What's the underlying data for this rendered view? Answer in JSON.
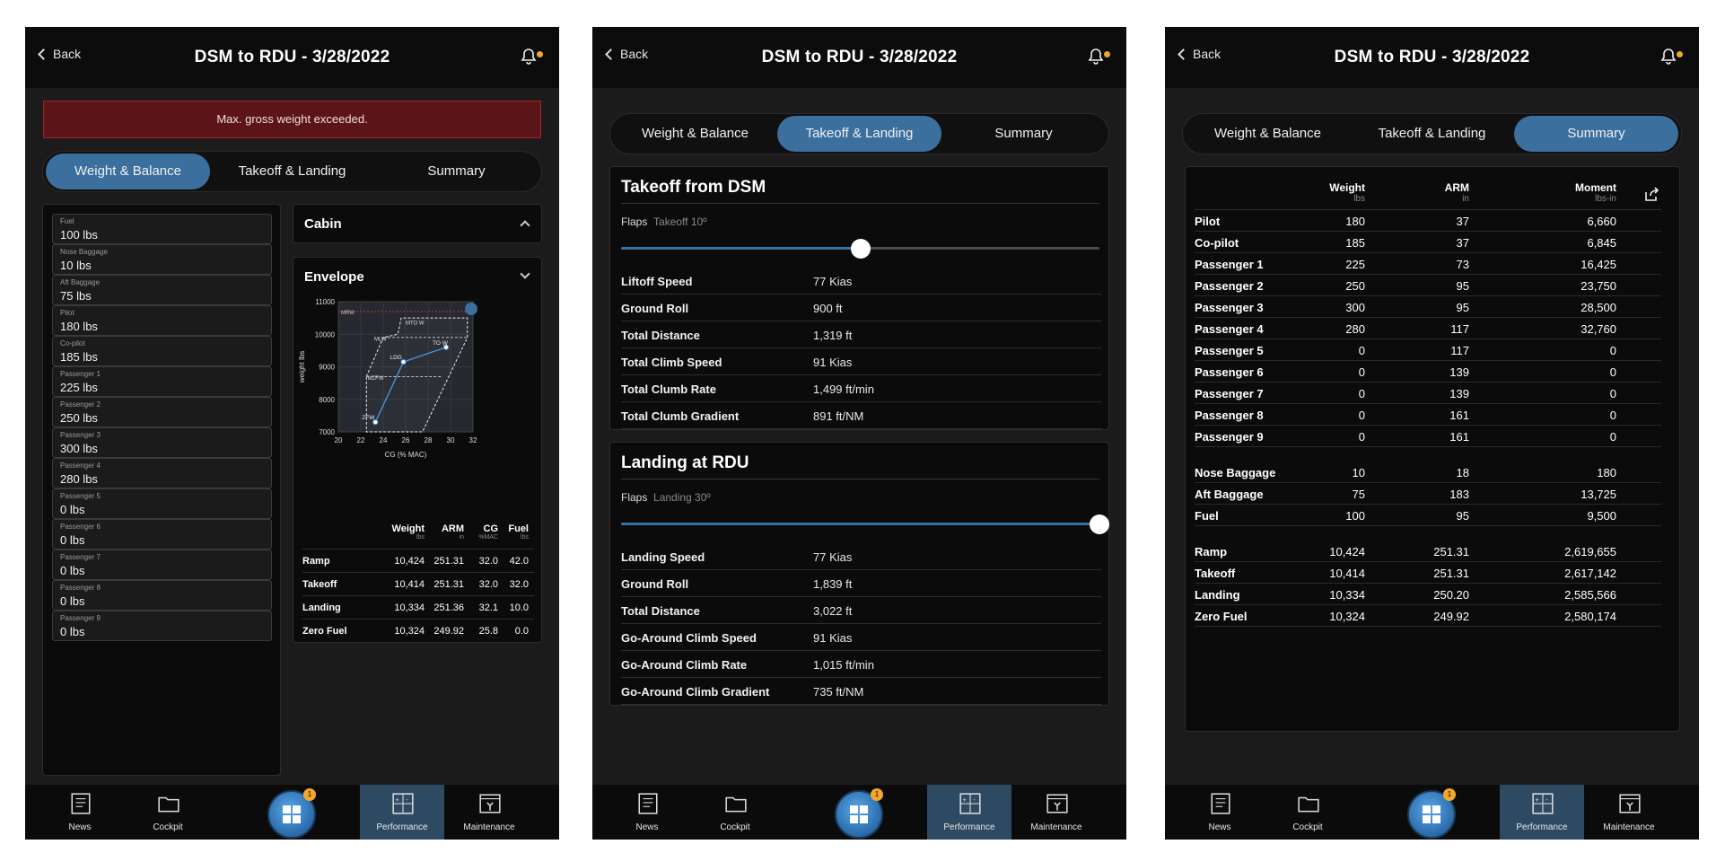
{
  "app": {
    "back_label": "Back",
    "title": "DSM to RDU - 3/28/2022",
    "tabs": [
      "Weight & Balance",
      "Takeoff & Landing",
      "Summary"
    ],
    "accent_color": "#3b6f9d",
    "notification_dot_color": "#f4a62a",
    "nav": [
      {
        "label": "News",
        "icon": "news-icon"
      },
      {
        "label": "Cockpit",
        "icon": "folder-icon"
      },
      {
        "label": "",
        "icon": "home-grid-icon",
        "badge": "1"
      },
      {
        "label": "Performance",
        "icon": "calculator-icon"
      },
      {
        "label": "Maintenance",
        "icon": "wrench-icon"
      }
    ]
  },
  "wb": {
    "alert": "Max. gross weight exceeded.",
    "fields": [
      {
        "label": "Fuel",
        "value": "100 lbs"
      },
      {
        "label": "Nose Baggage",
        "value": "10 lbs"
      },
      {
        "label": "Aft Baggage",
        "value": "75 lbs"
      },
      {
        "label": "Pilot",
        "value": "180 lbs"
      },
      {
        "label": "Co-pilot",
        "value": "185 lbs"
      },
      {
        "label": "Passenger 1",
        "value": "225 lbs"
      },
      {
        "label": "Passenger 2",
        "value": "250 lbs"
      },
      {
        "label": "Passenger 3",
        "value": "300 lbs"
      },
      {
        "label": "Passenger 4",
        "value": "280 lbs"
      },
      {
        "label": "Passenger 5",
        "value": "0 lbs"
      },
      {
        "label": "Passenger 6",
        "value": "0 lbs"
      },
      {
        "label": "Passenger 7",
        "value": "0 lbs"
      },
      {
        "label": "Passenger 8",
        "value": "0 lbs"
      },
      {
        "label": "Passenger 9",
        "value": "0 lbs"
      }
    ],
    "cabin_title": "Cabin",
    "envelope_title": "Envelope",
    "table_headers": [
      {
        "label": "Weight",
        "unit": "lbs"
      },
      {
        "label": "ARM",
        "unit": "in"
      },
      {
        "label": "CG",
        "unit": "%MAC"
      },
      {
        "label": "Fuel",
        "unit": "lbs"
      }
    ],
    "table_rows": [
      {
        "name": "Ramp",
        "weight": "10,424",
        "arm": "251.31",
        "cg": "32.0",
        "fuel": "42.0"
      },
      {
        "name": "Takeoff",
        "weight": "10,414",
        "arm": "251.31",
        "cg": "32.0",
        "fuel": "32.0"
      },
      {
        "name": "Landing",
        "weight": "10,334",
        "arm": "251.36",
        "cg": "32.1",
        "fuel": "10.0"
      },
      {
        "name": "Zero Fuel",
        "weight": "10,324",
        "arm": "249.92",
        "cg": "25.8",
        "fuel": "0.0"
      }
    ]
  },
  "chart_data": {
    "type": "scatter",
    "title": "",
    "xlabel": "CG (% MAC)",
    "ylabel": "weight lbs",
    "xlim": [
      20,
      32
    ],
    "ylim": [
      7000,
      11000
    ],
    "x_ticks": [
      "20",
      "22",
      "24",
      "26",
      "28",
      "30",
      "32"
    ],
    "y_ticks": [
      "7000",
      "8000",
      "9000",
      "10000",
      "11000"
    ],
    "grid": true,
    "reference_lines": [
      {
        "label": "MRW",
        "y": 10700
      }
    ],
    "envelope_labels": [
      "MTO W",
      "MLW",
      "MZFW"
    ],
    "points": [
      {
        "label": "ZFW",
        "x": 23.3,
        "y": 7300
      },
      {
        "label": "LDG",
        "x": 25.8,
        "y": 9150
      },
      {
        "label": "TO W",
        "x": 29.6,
        "y": 9600
      }
    ]
  },
  "tl": {
    "takeoff_title": "Takeoff from DSM",
    "takeoff_flaps_label": "Flaps",
    "takeoff_flaps_value": "Takeoff 10º",
    "takeoff_slider_fraction": 0.5,
    "takeoff_rows": [
      {
        "k": "Liftoff Speed",
        "v": "77 Kias"
      },
      {
        "k": "Ground Roll",
        "v": "900 ft"
      },
      {
        "k": "Total Distance",
        "v": "1,319 ft"
      },
      {
        "k": "Total Climb Speed",
        "v": "91 Kias"
      },
      {
        "k": "Total Clumb Rate",
        "v": "1,499 ft/min"
      },
      {
        "k": "Total Clumb Gradient",
        "v": "891 ft/NM"
      }
    ],
    "landing_title": "Landing at RDU",
    "landing_flaps_label": "Flaps",
    "landing_flaps_value": "Landing 30º",
    "landing_slider_fraction": 1.0,
    "landing_rows": [
      {
        "k": "Landing Speed",
        "v": "77 Kias"
      },
      {
        "k": "Ground Roll",
        "v": "1,839 ft"
      },
      {
        "k": "Total Distance",
        "v": "3,022 ft"
      },
      {
        "k": "Go-Around Climb Speed",
        "v": "91 Kias"
      },
      {
        "k": "Go-Around Climb Rate",
        "v": "1,015 ft/min"
      },
      {
        "k": "Go-Around Climb Gradient",
        "v": "735 ft/NM"
      }
    ]
  },
  "summary": {
    "headers": [
      {
        "label": "Weight",
        "unit": "lbs"
      },
      {
        "label": "ARM",
        "unit": "in"
      },
      {
        "label": "Moment",
        "unit": "lbs-in"
      }
    ],
    "group1": [
      {
        "name": "Pilot",
        "w": "180",
        "a": "37",
        "m": "6,660"
      },
      {
        "name": "Co-pilot",
        "w": "185",
        "a": "37",
        "m": "6,845"
      },
      {
        "name": "Passenger 1",
        "w": "225",
        "a": "73",
        "m": "16,425"
      },
      {
        "name": "Passenger 2",
        "w": "250",
        "a": "95",
        "m": "23,750"
      },
      {
        "name": "Passenger 3",
        "w": "300",
        "a": "95",
        "m": "28,500"
      },
      {
        "name": "Passenger 4",
        "w": "280",
        "a": "117",
        "m": "32,760"
      },
      {
        "name": "Passenger 5",
        "w": "0",
        "a": "117",
        "m": "0"
      },
      {
        "name": "Passenger 6",
        "w": "0",
        "a": "139",
        "m": "0"
      },
      {
        "name": "Passenger 7",
        "w": "0",
        "a": "139",
        "m": "0"
      },
      {
        "name": "Passenger 8",
        "w": "0",
        "a": "161",
        "m": "0"
      },
      {
        "name": "Passenger 9",
        "w": "0",
        "a": "161",
        "m": "0"
      }
    ],
    "group2": [
      {
        "name": "Nose Baggage",
        "w": "10",
        "a": "18",
        "m": "180"
      },
      {
        "name": "Aft Baggage",
        "w": "75",
        "a": "183",
        "m": "13,725"
      },
      {
        "name": "Fuel",
        "w": "100",
        "a": "95",
        "m": "9,500"
      }
    ],
    "group3": [
      {
        "name": "Ramp",
        "w": "10,424",
        "a": "251.31",
        "m": "2,619,655"
      },
      {
        "name": "Takeoff",
        "w": "10,414",
        "a": "251.31",
        "m": "2,617,142"
      },
      {
        "name": "Landing",
        "w": "10,334",
        "a": "250.20",
        "m": "2,585,566"
      },
      {
        "name": "Zero Fuel",
        "w": "10,324",
        "a": "249.92",
        "m": "2,580,174"
      }
    ]
  }
}
